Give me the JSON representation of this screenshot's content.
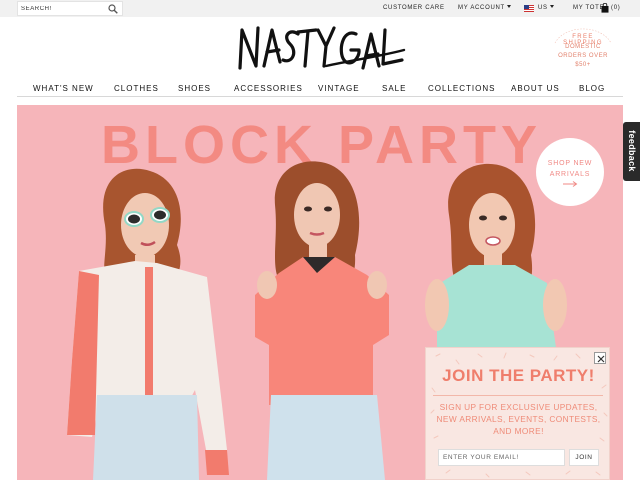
{
  "topbar": {
    "search_placeholder": "SEARCH!",
    "customer_care": "CUSTOMER CARE",
    "my_account": "MY ACCOUNT",
    "country": "US",
    "my_tote": "MY TOTE",
    "tote_count": "(0)"
  },
  "logo": {
    "text": "NASTY GAL"
  },
  "shipping_badge": {
    "line1": "FREE SHIPPING",
    "line2": "DOMESTIC",
    "line3": "ORDERS OVER",
    "line4": "$50+"
  },
  "nav": {
    "items": [
      "WHAT'S NEW",
      "CLOTHES",
      "SHOES",
      "ACCESSORIES",
      "VINTAGE",
      "SALE",
      "COLLECTIONS",
      "ABOUT US",
      "BLOG"
    ]
  },
  "hero": {
    "title": "BLOCK PARTY",
    "cta_line1": "SHOP NEW",
    "cta_line2": "ARRIVALS"
  },
  "feedback": {
    "label": "feedback"
  },
  "popup": {
    "title": "JOIN THE PARTY!",
    "text": "SIGN UP FOR EXCLUSIVE UPDATES, NEW ARRIVALS, EVENTS, CONTESTS, AND MORE!",
    "email_placeholder": "ENTER YOUR EMAIL!",
    "join_label": "JOIN"
  },
  "colors": {
    "hero_bg": "#f6b5ba",
    "hero_title": "#f38a82",
    "accent": "#ef7e6c",
    "popup_bg": "#f9e7e2"
  }
}
